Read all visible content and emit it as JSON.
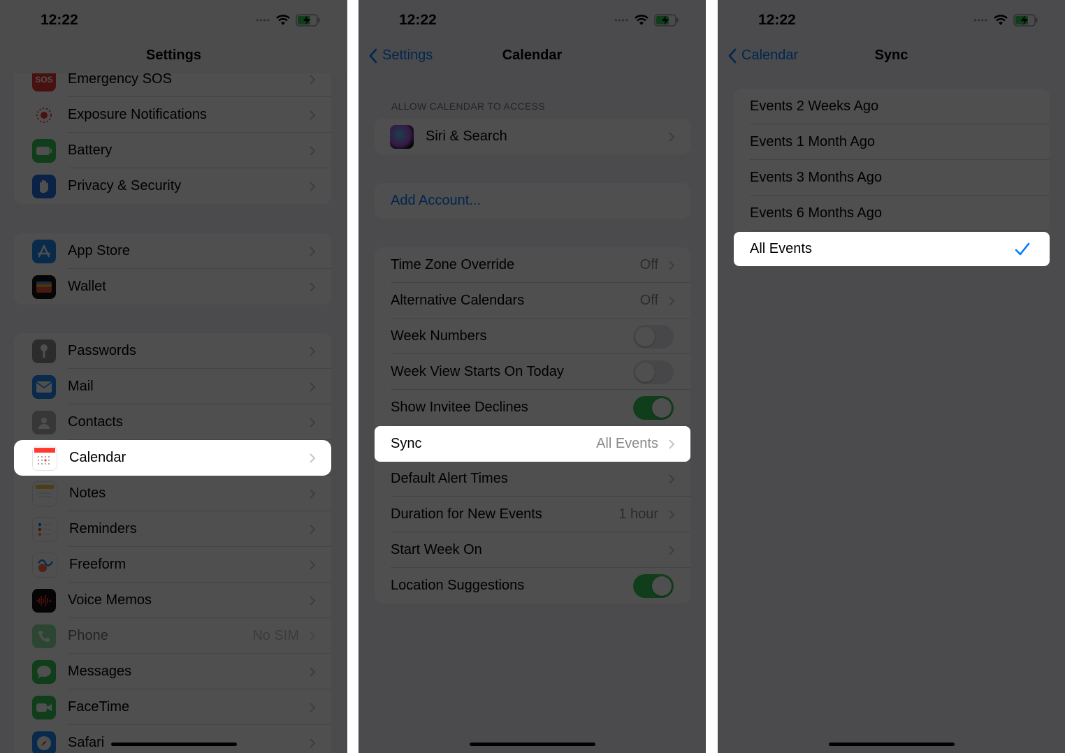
{
  "colors": {
    "accent": "#007aff",
    "toggle_on": "#34c759",
    "background": "#f2f2f7"
  },
  "status": {
    "time": "12:22"
  },
  "screen1": {
    "title": "Settings",
    "group1": [
      {
        "label": "Emergency SOS",
        "icon": "sos-icon",
        "color": "#e53935"
      },
      {
        "label": "Exposure Notifications",
        "icon": "exposure-icon",
        "color": "#ffffff"
      },
      {
        "label": "Battery",
        "icon": "battery-icon",
        "color": "#34c759"
      },
      {
        "label": "Privacy & Security",
        "icon": "hand-icon",
        "color": "#1e6fe0"
      }
    ],
    "group2": [
      {
        "label": "App Store",
        "icon": "app-store-icon",
        "color": "#1c8bf0"
      },
      {
        "label": "Wallet",
        "icon": "wallet-icon",
        "color": "#111111"
      }
    ],
    "group3": [
      {
        "label": "Passwords",
        "icon": "key-icon",
        "color": "#8e8e93",
        "value": ""
      },
      {
        "label": "Mail",
        "icon": "mail-icon",
        "color": "#1e88f0",
        "value": ""
      },
      {
        "label": "Contacts",
        "icon": "contacts-icon",
        "color": "#b0b0b5",
        "value": ""
      },
      {
        "label": "Calendar",
        "icon": "calendar-icon",
        "color": "#ffffff",
        "value": ""
      },
      {
        "label": "Notes",
        "icon": "notes-icon",
        "color": "#ffffff",
        "value": ""
      },
      {
        "label": "Reminders",
        "icon": "reminders-icon",
        "color": "#ffffff",
        "value": ""
      },
      {
        "label": "Freeform",
        "icon": "freeform-icon",
        "color": "#ffffff",
        "value": ""
      },
      {
        "label": "Voice Memos",
        "icon": "voice-memos-icon",
        "color": "#111111",
        "value": ""
      },
      {
        "label": "Phone",
        "icon": "phone-icon",
        "color": "#34c759",
        "value": "No SIM"
      },
      {
        "label": "Messages",
        "icon": "messages-icon",
        "color": "#34c759",
        "value": ""
      },
      {
        "label": "FaceTime",
        "icon": "facetime-icon",
        "color": "#34c759",
        "value": ""
      },
      {
        "label": "Safari",
        "icon": "safari-icon",
        "color": "#1e88f0",
        "value": ""
      }
    ]
  },
  "screen2": {
    "back_label": "Settings",
    "title": "Calendar",
    "section_header": "ALLOW CALENDAR TO ACCESS",
    "siri_label": "Siri & Search",
    "add_account_label": "Add Account...",
    "rows": [
      {
        "label": "Time Zone Override",
        "value": "Off",
        "kind": "chevron"
      },
      {
        "label": "Alternative Calendars",
        "value": "Off",
        "kind": "chevron"
      },
      {
        "label": "Week Numbers",
        "value": "",
        "kind": "toggle-off"
      },
      {
        "label": "Week View Starts On Today",
        "value": "",
        "kind": "toggle-off"
      },
      {
        "label": "Show Invitee Declines",
        "value": "",
        "kind": "toggle-on"
      },
      {
        "label": "Sync",
        "value": "All Events",
        "kind": "chevron"
      },
      {
        "label": "Default Alert Times",
        "value": "",
        "kind": "chevron"
      },
      {
        "label": "Duration for New Events",
        "value": "1 hour",
        "kind": "chevron"
      },
      {
        "label": "Start Week On",
        "value": "",
        "kind": "chevron"
      },
      {
        "label": "Location Suggestions",
        "value": "",
        "kind": "toggle-on"
      }
    ]
  },
  "screen3": {
    "back_label": "Calendar",
    "title": "Sync",
    "options": [
      {
        "label": "Events 2 Weeks Ago",
        "selected": false
      },
      {
        "label": "Events 1 Month Ago",
        "selected": false
      },
      {
        "label": "Events 3 Months Ago",
        "selected": false
      },
      {
        "label": "Events 6 Months Ago",
        "selected": false
      },
      {
        "label": "All Events",
        "selected": true
      }
    ]
  }
}
